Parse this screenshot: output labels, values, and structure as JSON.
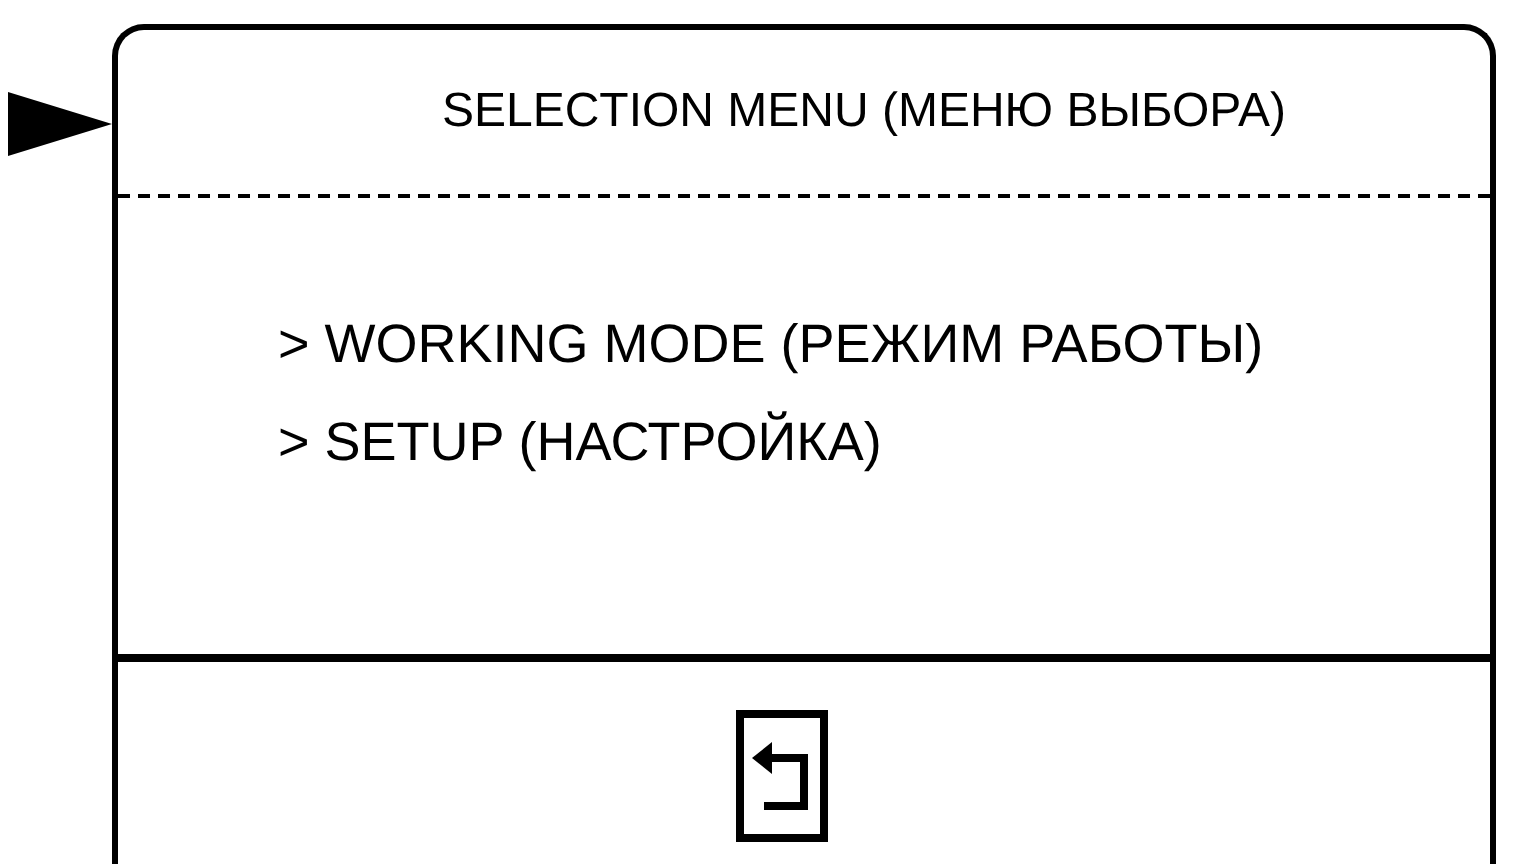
{
  "screen": {
    "title": "SELECTION MENU (МЕНЮ ВЫБОРА)",
    "items": [
      {
        "label": "> WORKING MODE (РЕЖИМ РАБОТЫ)"
      },
      {
        "label": "> SETUP (НАСТРОЙКА)"
      }
    ]
  }
}
